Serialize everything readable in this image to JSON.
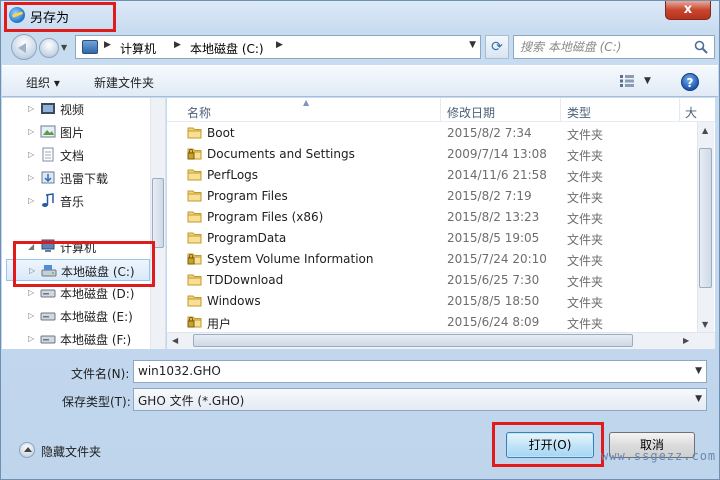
{
  "window": {
    "title": "另存为",
    "close_glyph": "x"
  },
  "nav": {
    "breadcrumb": [
      "计算机",
      "本地磁盘 (C:)"
    ],
    "search_placeholder": "搜索 本地磁盘 (C:)"
  },
  "toolbar": {
    "organize_label": "组织 ▾",
    "new_folder_label": "新建文件夹",
    "help_glyph": "?"
  },
  "nav_pane": {
    "items": [
      {
        "label": "视频",
        "icon": "video-icon"
      },
      {
        "label": "图片",
        "icon": "picture-icon"
      },
      {
        "label": "文档",
        "icon": "document-icon"
      },
      {
        "label": "迅雷下载",
        "icon": "download-icon"
      },
      {
        "label": "音乐",
        "icon": "music-icon"
      },
      {
        "label": "计算机",
        "icon": "computer-icon"
      },
      {
        "label": "本地磁盘 (C:)",
        "icon": "drive-icon",
        "selected": true
      },
      {
        "label": "本地磁盘 (D:)",
        "icon": "drive-icon"
      },
      {
        "label": "本地磁盘 (E:)",
        "icon": "drive-icon"
      },
      {
        "label": "本地磁盘 (F:)",
        "icon": "drive-icon"
      }
    ]
  },
  "file_list": {
    "columns": {
      "name": "名称",
      "date": "修改日期",
      "type": "类型",
      "size": "大"
    },
    "rows": [
      {
        "name": "Boot",
        "date": "2015/8/2 7:34",
        "type": "文件夹",
        "locked": false
      },
      {
        "name": "Documents and Settings",
        "date": "2009/7/14 13:08",
        "type": "文件夹",
        "locked": true
      },
      {
        "name": "PerfLogs",
        "date": "2014/11/6 21:58",
        "type": "文件夹",
        "locked": false
      },
      {
        "name": "Program Files",
        "date": "2015/8/2 7:19",
        "type": "文件夹",
        "locked": false
      },
      {
        "name": "Program Files (x86)",
        "date": "2015/8/2 13:23",
        "type": "文件夹",
        "locked": false
      },
      {
        "name": "ProgramData",
        "date": "2015/8/5 19:05",
        "type": "文件夹",
        "locked": false
      },
      {
        "name": "System Volume Information",
        "date": "2015/7/24 20:10",
        "type": "文件夹",
        "locked": true
      },
      {
        "name": "TDDownload",
        "date": "2015/6/25 7:30",
        "type": "文件夹",
        "locked": false
      },
      {
        "name": "Windows",
        "date": "2015/8/5 18:50",
        "type": "文件夹",
        "locked": false
      },
      {
        "name": "用户",
        "date": "2015/6/24 8:09",
        "type": "文件夹",
        "locked": true
      }
    ]
  },
  "form": {
    "filename_label": "文件名(N):",
    "filename_value": "win1032.GHO",
    "filetype_label": "保存类型(T):",
    "filetype_value": "GHO 文件 (*.GHO)"
  },
  "footer": {
    "hide_folders_label": "隐藏文件夹",
    "open_label": "打开(O)",
    "cancel_label": "取消",
    "watermark": "www.ssgezz.com"
  },
  "colors": {
    "highlight": "#e01b1b",
    "accent": "#3c7fb1",
    "folder": "#f2d27a"
  }
}
